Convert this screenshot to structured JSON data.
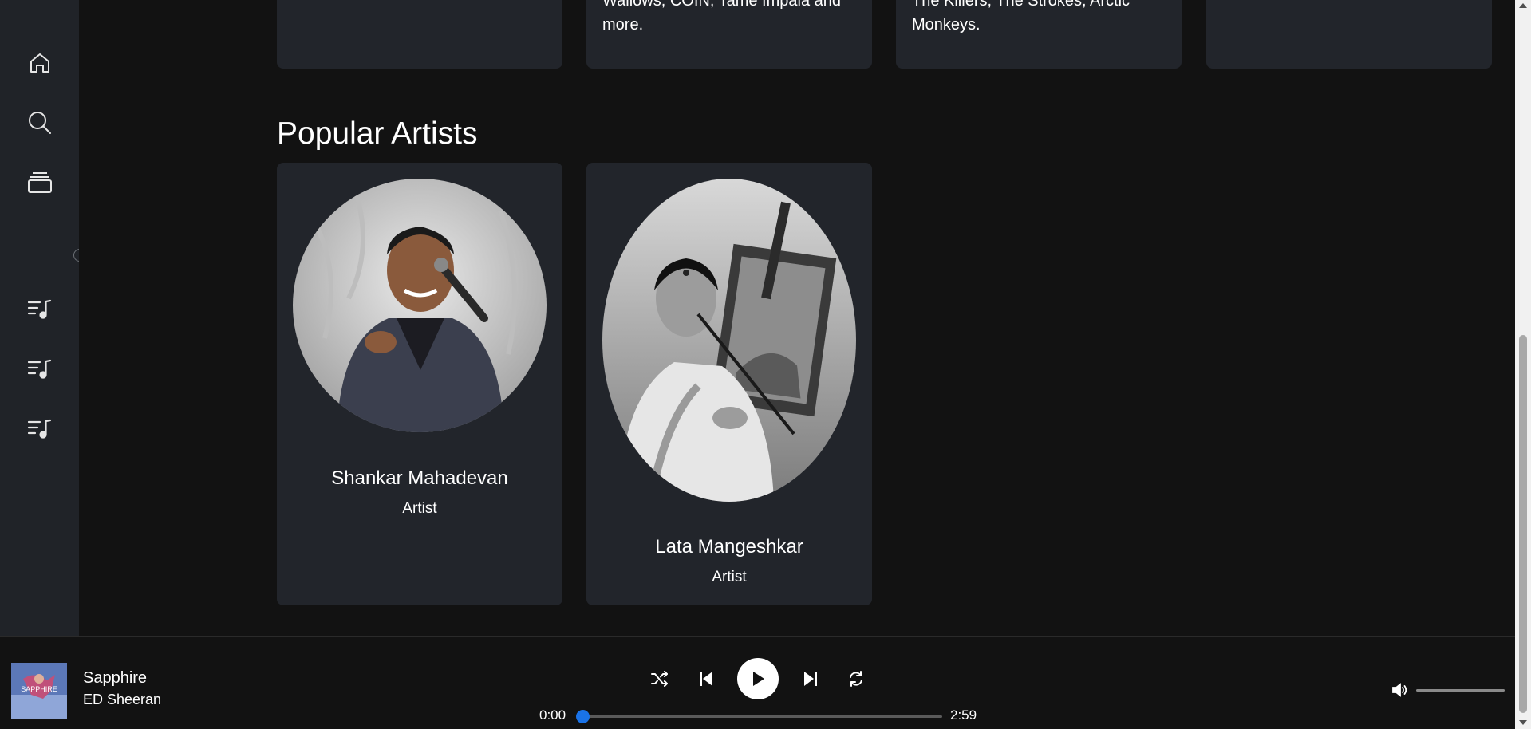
{
  "sidebar": {
    "icons": [
      "home-icon",
      "search-icon",
      "library-icon",
      "playlist-icon",
      "playlist-icon",
      "playlist-icon"
    ]
  },
  "top_cards": [
    {
      "text": ""
    },
    {
      "text": "Wallows, COIN, Tame Impala and more."
    },
    {
      "text": "The Killers, The Strokes, Arctic Monkeys."
    },
    {
      "text": ""
    }
  ],
  "section": {
    "title": "Popular Artists"
  },
  "artists": [
    {
      "name": "Shankar Mahadevan",
      "role": "Artist"
    },
    {
      "name": "Lata Mangeshkar",
      "role": "Artist"
    }
  ],
  "player": {
    "track_title": "Sapphire",
    "track_artist": "ED Sheeran",
    "cover_text": "SAPPHIRE",
    "current_time": "0:00",
    "total_time": "2:59",
    "progress": 0.0,
    "volume": 1.0,
    "controls": [
      "shuffle-icon",
      "previous-icon",
      "play-icon",
      "next-icon",
      "repeat-icon"
    ]
  },
  "colors": {
    "background": "#121212",
    "sidebar": "#202328",
    "card": "#22252b",
    "accent": "#1a73e8"
  }
}
